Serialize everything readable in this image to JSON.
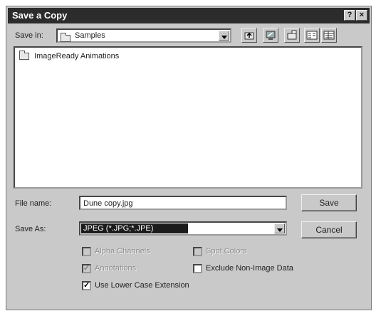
{
  "window": {
    "title": "Save a Copy",
    "help_button": "?",
    "close_button": "×"
  },
  "savein": {
    "label": "Save in:",
    "value": "Samples"
  },
  "files": [
    {
      "name": "ImageReady Animations"
    }
  ],
  "filename": {
    "label": "File name:",
    "value": "Dune copy.jpg"
  },
  "saveas": {
    "label": "Save As:",
    "value": "JPEG (*.JPG;*.JPE)"
  },
  "buttons": {
    "save": "Save",
    "cancel": "Cancel"
  },
  "options": {
    "alpha_channels": {
      "label": "Alpha Channels",
      "checked": false,
      "enabled": false
    },
    "spot_colors": {
      "label": "Spot Colors",
      "checked": false,
      "enabled": false
    },
    "annotations": {
      "label": "Annotations",
      "checked": false,
      "enabled": false
    },
    "exclude_nonimage": {
      "label": "Exclude Non-Image Data",
      "checked": false,
      "enabled": true
    },
    "use_lowercase": {
      "label": "Use Lower Case Extension",
      "checked": true,
      "enabled": true
    }
  },
  "toolbar_icons": [
    "up-one-level-icon",
    "desktop-icon",
    "create-new-folder-icon",
    "list-view-icon",
    "details-view-icon"
  ]
}
